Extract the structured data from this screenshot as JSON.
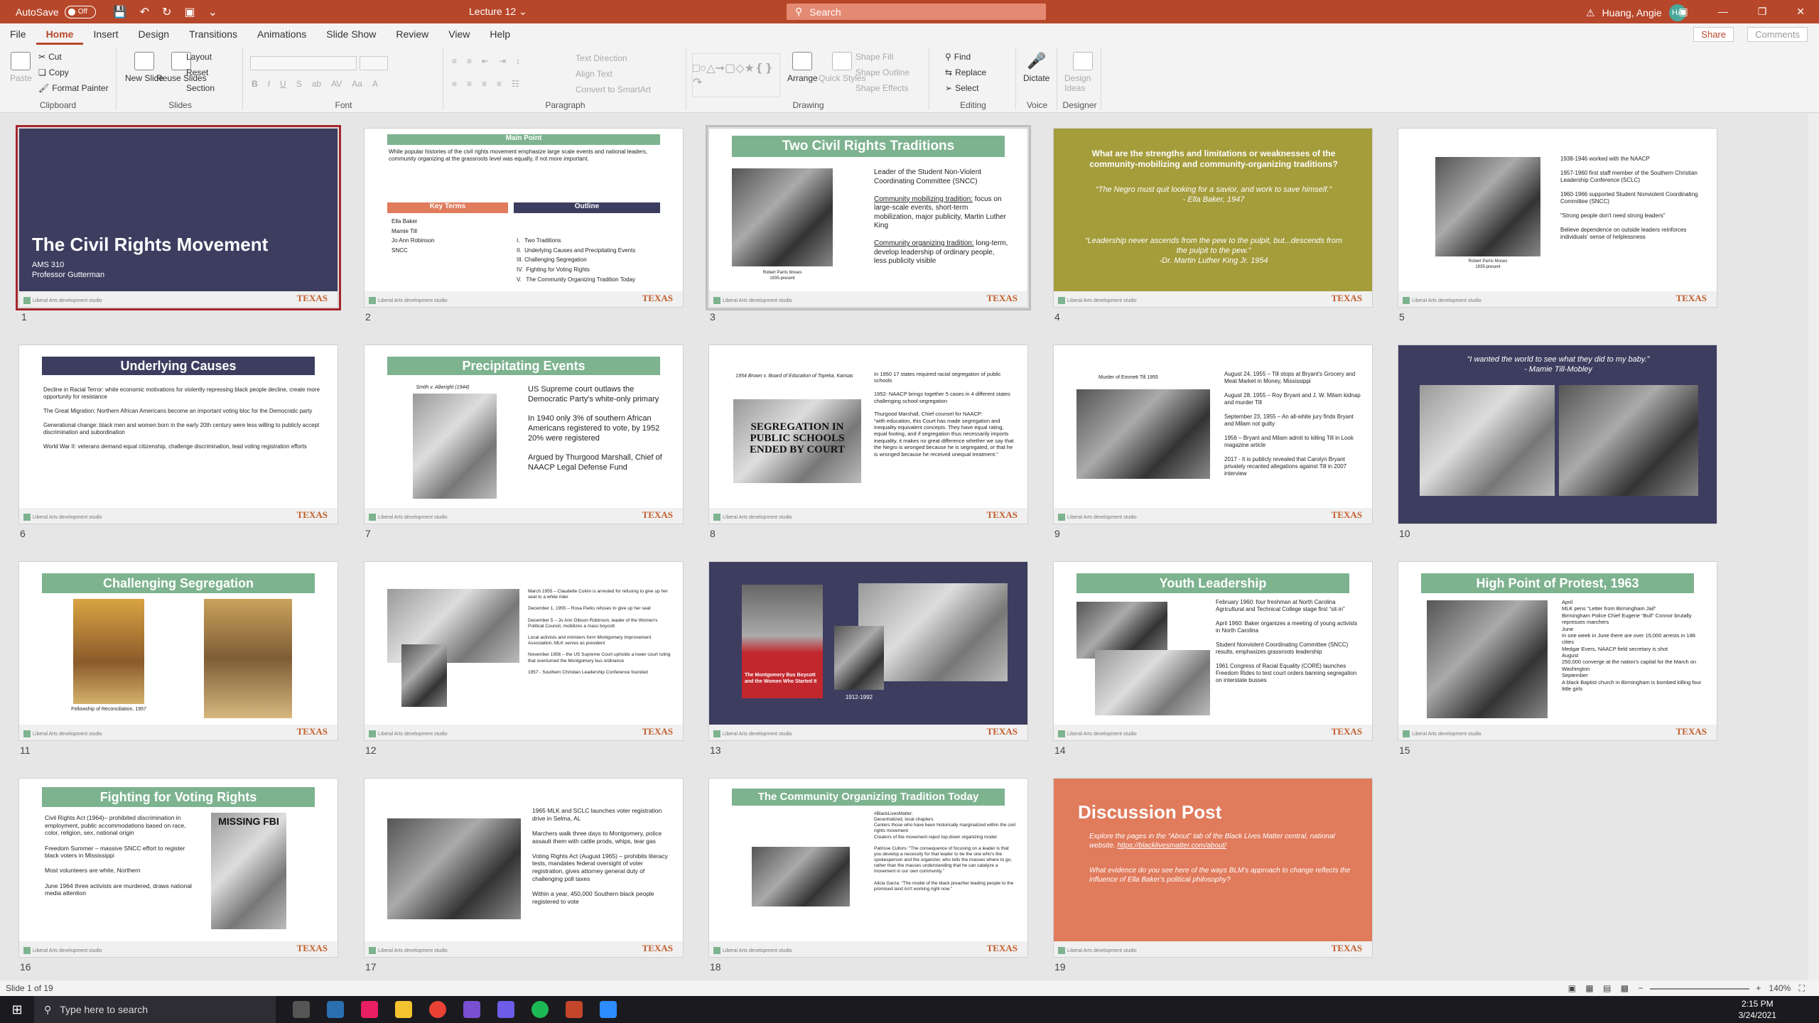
{
  "titlebar": {
    "autosave_label": "AutoSave",
    "autosave_state": "Off",
    "doc_title": "Lecture 12",
    "search_placeholder": "Search",
    "user_name": "Huang, Angie",
    "user_initials": "HA"
  },
  "tabs": [
    "File",
    "Home",
    "Insert",
    "Design",
    "Transitions",
    "Animations",
    "Slide Show",
    "Review",
    "View",
    "Help"
  ],
  "active_tab": "Home",
  "share_label": "Share",
  "comments_label": "Comments",
  "ribbon": {
    "clipboard": {
      "label": "Clipboard",
      "paste": "Paste",
      "cut": "Cut",
      "copy": "Copy",
      "format_painter": "Format Painter"
    },
    "slides": {
      "label": "Slides",
      "new_slide": "New Slide",
      "reuse_slides": "Reuse Slides",
      "layout": "Layout",
      "reset": "Reset",
      "section": "Section"
    },
    "font": {
      "label": "Font"
    },
    "paragraph": {
      "label": "Paragraph",
      "text_direction": "Text Direction",
      "align_text": "Align Text",
      "convert_smartart": "Convert to SmartArt"
    },
    "drawing": {
      "label": "Drawing",
      "arrange": "Arrange",
      "quick_styles": "Quick Styles",
      "shape_fill": "Shape Fill",
      "shape_outline": "Shape Outline",
      "shape_effects": "Shape Effects"
    },
    "editing": {
      "label": "Editing",
      "find": "Find",
      "replace": "Replace",
      "select": "Select"
    },
    "voice": {
      "label": "Voice",
      "dictate": "Dictate"
    },
    "designer": {
      "label": "Designer",
      "design_ideas": "Design Ideas"
    }
  },
  "footer_brand": "Liberal Arts development studio",
  "texas_logo": "TEXAS",
  "slides": {
    "s1": {
      "num": "1",
      "title": "The Civil Rights Movement",
      "sub1": "AMS 310",
      "sub2": "Professor Gutterman"
    },
    "s2": {
      "num": "2",
      "main_point": "Main Point",
      "main_text": "While popular histories of the civil rights movement emphasize large scale events and national leaders, community organizing at the grassroots level was equally, if not more important.",
      "key_terms": "Key Terms",
      "terms": [
        "Ella Baker",
        "Mamie Till",
        "Jo Ann Robinson",
        "SNCC"
      ],
      "outline": "Outline",
      "outline_items": [
        "I.   Two Traditions",
        "II.  Underlying Causes and Precipitating Events",
        "III. Challenging Segregation",
        "IV.  Fighting for Voting Rights",
        "V.   The Community Organizing Tradition Today"
      ]
    },
    "s3": {
      "num": "3",
      "title": "Two Civil Rights Traditions",
      "caption": "Robert Parris Moses",
      "caption2": "1935-present",
      "p1": "Leader of the Student Non-Violent Coordinating Committee (SNCC)",
      "p2h": "Community mobilizing tradition:",
      "p2": "focus on large-scale events, short-term mobilization, major publicity, Martin Luther King",
      "p3h": "Community organizing tradition:",
      "p3": "long-term, develop leadership of ordinary people, less publicity visible"
    },
    "s4": {
      "num": "4",
      "title": "What are the strengths and limitations or weaknesses of the community-mobilizing and community-organizing traditions?",
      "q1": "“The Negro must quit looking for a savior, and work to save himself.”",
      "q1a": "-  Ella Baker, 1947",
      "q2": "“Leadership never ascends from the pew to the pulpit, but...descends from the pulpit to the pew.”",
      "q2a": "-Dr. Martin Luther King Jr. 1954"
    },
    "s5": {
      "num": "5",
      "caption": "Robert Parris Moses",
      "caption2": "1935-present",
      "bullets": [
        "1938-1946 worked with the NAACP",
        "1957-1960 first staff member of the Southern Christian Leadership Conference (SCLC)",
        "1960-1966 supported Student Nonviolent Coordinating Committee (SNCC)",
        "“Strong people don't need strong leaders”",
        "Believe dependence on outside leaders reinforces individuals' sense of helplessness"
      ]
    },
    "s6": {
      "num": "6",
      "title": "Underlying Causes",
      "items": [
        "Decline in Racial Terror: white economic motivations for violently repressing black people decline, create more opportunity for resistance",
        "The Great Migration: Northern African Americans become an important voting bloc for the Democratic party",
        "Generational change: black men and women born in the early 20th century were less willing to publicly accept discrimination and subordination",
        "World War II: veterans demand equal citizenship, challenge discrimination, lead voting registration efforts"
      ]
    },
    "s7": {
      "num": "7",
      "title": "Precipitating Events",
      "caption": "Smith v. Allwright (1944)",
      "bullets": [
        "US Supreme court outlaws the Democratic Party's white-only primary",
        "In 1940 only 3% of southern African Americans registered to vote, by 1952 20% were registered",
        "Argued by Thurgood Marshall, Chief of NAACP Legal Defense Fund"
      ]
    },
    "s8": {
      "num": "8",
      "caption": "1954 Brown v. Board of Education of Topeka, Kansas",
      "headline": "SEGREGATION IN PUBLIC SCHOOLS ENDED BY COURT",
      "bullets": [
        "In 1950 17 states required racial segregation of public schools",
        "1952: NAACP brings together 5 cases in 4 different states challenging school segregation",
        "Thurgood Marshall, Chief counsel for NAACP:",
        "“with education, this Court has made segregation and inequality equivalent concepts. They have equal rating, equal footing, and if segregation thus necessarily imports inequality, it makes no great difference whether we say that the Negro is wronged because he is segregated, or that he is wronged because he received unequal treatment.”"
      ]
    },
    "s9": {
      "num": "9",
      "caption": "Murder of Emmett Till 1955",
      "bullets": [
        "August 24, 1955 – Till stops at Bryant's Grocery and Meat Market in Money, Mississippi",
        "August 28, 1955 – Roy Bryant and J. W. Milam kidnap and murder Till",
        "September 23, 1955 – An all-white jury finds Bryant and Milam not guilty",
        "1956 – Bryant and Milam admit to killing Till in Look magazine article",
        "2017 - It is publicly revealed that Carolyn Bryant privately recanted allegations against Till in 2007 interview"
      ]
    },
    "s10": {
      "num": "10",
      "quote": "“I wanted the world to see what they did to my baby.”",
      "attr": "- Mamie Till-Mobley"
    },
    "s11": {
      "num": "11",
      "title": "Challenging Segregation",
      "caption": "Fellowship of Reconciliation, 1957"
    },
    "s12": {
      "num": "12",
      "items": [
        "March 1955 – Claudette Colvin is arrested for refusing to give up her seat to a white rider",
        "December 1, 1955 – Rosa Parks refuses to give up her seat",
        "December 5 – Jo Ann Gibson Robinson, leader of the Women's Political Council, mobilizes a mass boycott",
        "Local activists and ministers form Montgomery Improvement Association, MLK serves as president",
        "November 1956 – the US Supreme Court upholds a lower court ruling that overturned the Montgomery bus ordinance",
        "1957 - Southern Christian Leadership Conference founded"
      ]
    },
    "s13": {
      "num": "13",
      "book": "The Montgomery Bus Boycott and the Women Who Started It",
      "years": "1912-1992"
    },
    "s14": {
      "num": "14",
      "title": "Youth Leadership",
      "bullets": [
        "February 1960: four freshman at North Carolina Agricultural and Technical College stage first “sit-in”",
        "April 1960: Baker organizes a meeting of young activists in North Carolina",
        "Student Nonviolent Coordinating Committee (SNCC) results, emphasizes grassroots leadership",
        "1961 Congress of Racial Equality (CORE) launches Freedom Rides to test court orders banning segregation on interstate busses"
      ]
    },
    "s15": {
      "num": "15",
      "title": "High Point of Protest, 1963",
      "items": [
        "April",
        "MLK pens “Letter from Birmingham Jail”",
        "Birmingham Police Chief Eugene “Bull” Connor brutally represses marchers",
        "June",
        "In one week in June there are over 15,000 arrests in 186 cities",
        "Medgar Evers, NAACP field secretary is shot",
        "August",
        "250,000 converge at the nation's capital for the March on Washington",
        "September",
        "A black Baptist church in Birmingham is bombed killing four little girls"
      ]
    },
    "s16": {
      "num": "16",
      "title": "Fighting for Voting Rights",
      "missing": "MISSING FBI",
      "bullets": [
        "Civil Rights Act (1964)– prohibited discrimination in employment, public accommodations based on race, color, religion, sex, national origin",
        "Freedom Summer – massive SNCC effort to register black voters in Mississippi",
        "Most volunteers are white, Northern",
        "June 1964 three activists are murdered, draws national media attention"
      ]
    },
    "s17": {
      "num": "17",
      "bullets": [
        "1965 MLK and SCLC launches voter registration drive in Selma, AL",
        "Marchers walk three days to Montgomery, police assault them with cattle prods, whips, tear gas",
        "Voting Rights Act (August 1965) – prohibits literacy tests, mandates federal oversight of voter registration, gives attorney general duty of challenging poll taxes",
        "Within a year, 450,000 Southern black people registered to vote"
      ]
    },
    "s18": {
      "num": "18",
      "title": "The Community Organizing Tradition Today",
      "items": [
        "#BlackLivesMatter:",
        "Decentralized, local chapters",
        "Centers those who have been historically marginalized within the civil rights movement",
        "Creators of the movement reject top-down organizing model",
        "Patrisse Cullors: “The consequence of focusing on a leader is that you develop a necessity for that leader to be the one who's the spokesperson and the organizer, who tells the masses where to go, rather than the masses understanding that he can catalyze a movement in our own community.”",
        "Alicia Garza: “The model of the black preacher leading people to the promised land isn't working right now.”"
      ]
    },
    "s19": {
      "num": "19",
      "title": "Discussion Post",
      "b1": "Explore the pages in the “About” tab of the Black Lives Matter central, national website.",
      "link": "https://blacklivesmatter.com/about/",
      "b2": "What evidence do you see here of the ways BLM's approach to change reflects the influence of Ella Baker's political philosophy?"
    }
  },
  "status": {
    "slide_counter": "Slide 1 of 19",
    "zoom": "140%"
  },
  "taskbar": {
    "search_placeholder": "Type here to search",
    "time": "2:15 PM",
    "date": "3/24/2021"
  },
  "colors": {
    "accent": "#b7472a",
    "green": "#7db38f",
    "navy": "#3d3d60",
    "olive": "#a59c3c",
    "coral": "#e07b5c",
    "orange": "#c25d2b"
  }
}
